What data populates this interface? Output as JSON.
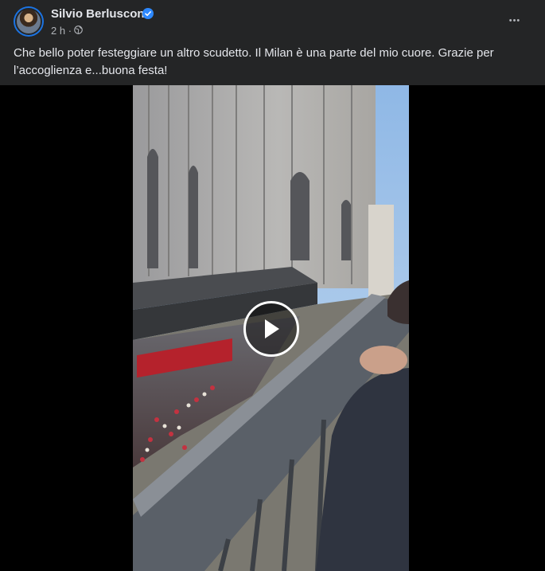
{
  "post": {
    "author": "Silvio Berlusconi",
    "time": "2 h",
    "separator": "·",
    "text": "Che bello poter festeggiare un altro scudetto. Il Milan è una parte del mio cuore. Grazie per l’accoglienza e...buona festa!",
    "more_label": "•••"
  },
  "icons": {
    "verified": "verified-badge-icon",
    "privacy": "globe-icon",
    "play": "play-icon"
  },
  "colors": {
    "background": "#242526",
    "text": "#e4e6eb",
    "secondary_text": "#b0b3b8",
    "verified": "#2d88ff"
  }
}
